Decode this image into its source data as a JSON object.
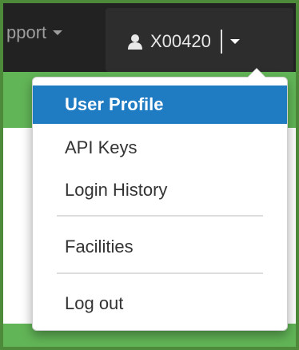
{
  "nav": {
    "support_label": "pport"
  },
  "user": {
    "id_label": "X00420"
  },
  "dropdown": {
    "items": [
      {
        "label": "User Profile",
        "active": true
      },
      {
        "label": "API Keys"
      },
      {
        "label": "Login History"
      },
      {
        "label": "Facilities"
      },
      {
        "label": "Log out"
      }
    ]
  },
  "colors": {
    "accent": "#1f7bc2",
    "navbar": "#222222",
    "page_background": "#62b557",
    "frame_border": "#4d8a3a"
  },
  "icons": [
    "user-icon",
    "caret-down-icon"
  ]
}
